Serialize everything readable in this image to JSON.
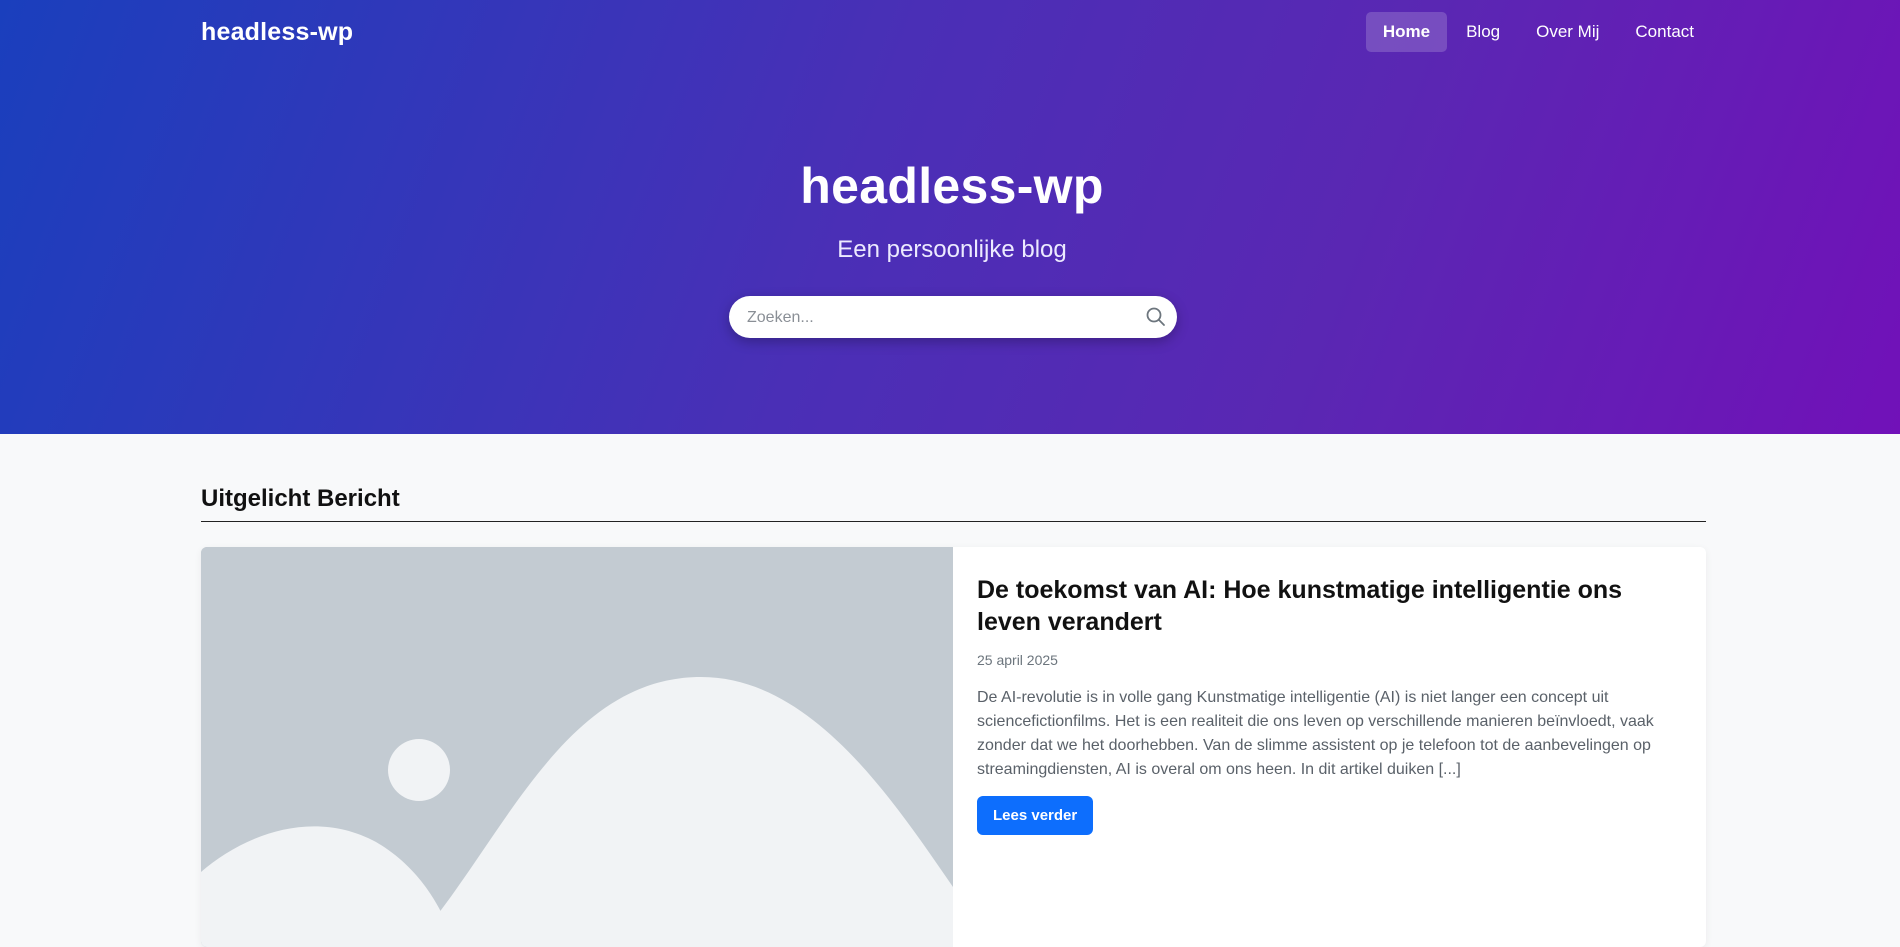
{
  "header": {
    "brand": "headless-wp",
    "nav": [
      {
        "label": "Home",
        "active": true
      },
      {
        "label": "Blog",
        "active": false
      },
      {
        "label": "Over Mij",
        "active": false
      },
      {
        "label": "Contact",
        "active": false
      }
    ]
  },
  "hero": {
    "title": "headless-wp",
    "subtitle": "Een persoonlijke blog",
    "search": {
      "placeholder": "Zoeken...",
      "value": "",
      "icon": "search-icon"
    }
  },
  "featured": {
    "section_title": "Uitgelicht Bericht",
    "post": {
      "image_icon": "image-placeholder-icon",
      "title": "De toekomst van AI: Hoe kunstmatige intelligentie ons leven verandert",
      "date": "25 april 2025",
      "excerpt": "De AI-revolutie is in volle gang Kunstmatige intelligentie (AI) is niet langer een concept uit sciencefictionfilms. Het is een realiteit die ons leven op verschillende manieren beïnvloedt, vaak zonder dat we het doorhebben. Van de slimme assistent op je telefoon tot de aanbevelingen op streamingdiensten, AI is overal om ons heen. In dit artikel duiken [...]",
      "read_more": "Lees verder"
    }
  },
  "colors": {
    "hero_gradient_start": "#1a3fbd",
    "hero_gradient_end": "#7111b8",
    "primary_button": "#0d6efd",
    "page_background": "#f8f9fa"
  }
}
